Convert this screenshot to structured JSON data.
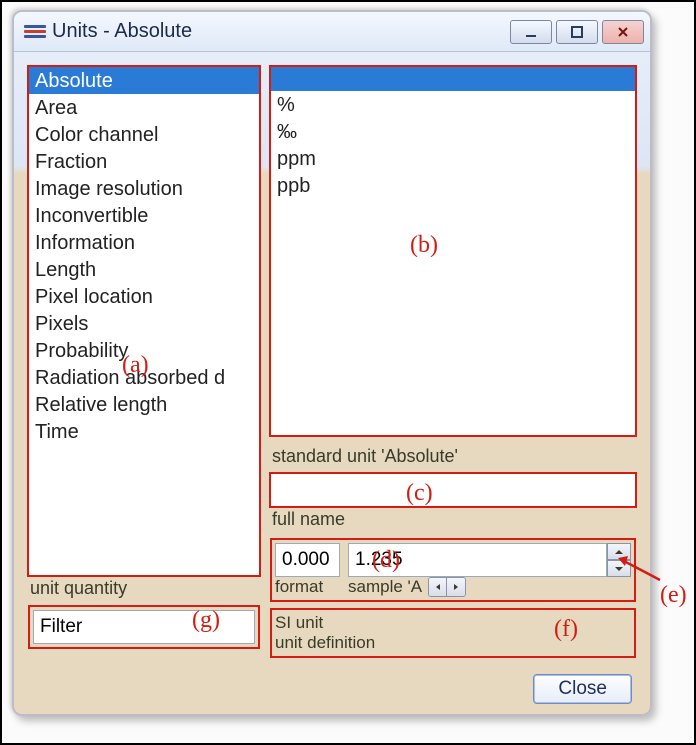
{
  "window": {
    "title": "Units - Absolute",
    "minimize_aria": "Minimize",
    "maximize_aria": "Maximize",
    "close_aria": "Close"
  },
  "left": {
    "selected": "Absolute",
    "items": [
      "Absolute",
      "Area",
      "Color channel",
      "Fraction",
      "Image resolution",
      "Inconvertible",
      "Information",
      "Length",
      "Pixel location",
      "Pixels",
      "Probability",
      "Radiation absorbed d",
      "Relative length",
      "Time"
    ],
    "caption": "unit quantity",
    "filter_placeholder": "Filter"
  },
  "right": {
    "units": [
      "%",
      "‰",
      "ppm",
      "ppb"
    ],
    "standard_unit_label": "standard unit 'Absolute'",
    "full_name_label": "full name",
    "full_name_value": "",
    "format_label": "format",
    "format_value": "0.000",
    "sample_label": "sample 'A",
    "sample_value": "1.235",
    "si_unit_label": "SI unit",
    "si_unit_value": "",
    "unit_definition_label": "unit definition",
    "close_label": "Close"
  },
  "annotations": {
    "a": "(a)",
    "b": "(b)",
    "c": "(c)",
    "d": "(d)",
    "e": "(e)",
    "f": "(f)",
    "g": "(g)"
  }
}
